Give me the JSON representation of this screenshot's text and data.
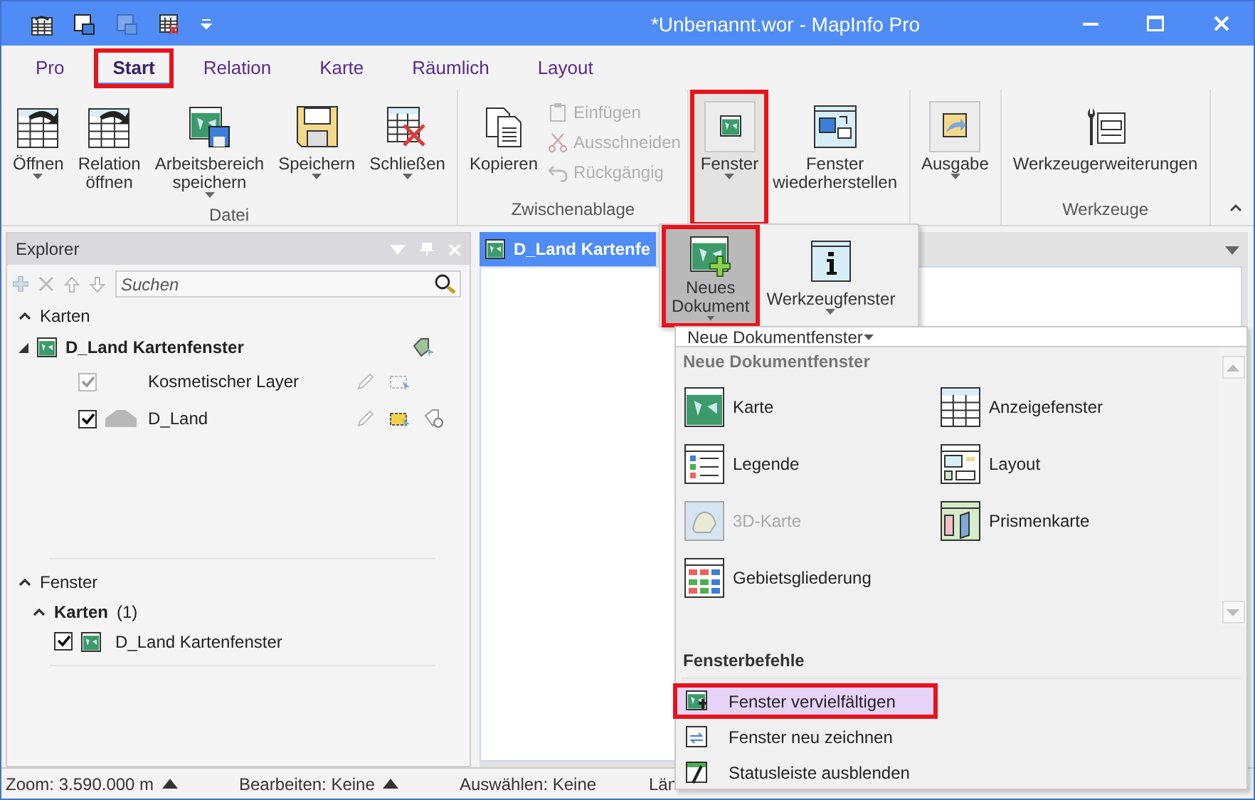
{
  "window": {
    "title": "*Unbenannt.wor - MapInfo Pro"
  },
  "tabs": [
    {
      "label": "Pro",
      "selected": false,
      "highlighted": false
    },
    {
      "label": "Start",
      "selected": true,
      "highlighted": true
    },
    {
      "label": "Relation",
      "selected": false,
      "highlighted": false
    },
    {
      "label": "Karte",
      "selected": false,
      "highlighted": false
    },
    {
      "label": "Räumlich",
      "selected": false,
      "highlighted": false
    },
    {
      "label": "Layout",
      "selected": false,
      "highlighted": false
    }
  ],
  "ribbon": {
    "groups": [
      {
        "label": "Datei",
        "buttons": [
          {
            "label": "Öffnen",
            "kind": "large",
            "dropdown": true,
            "pressed": false,
            "highlighted": false
          },
          {
            "label": "Relation\nöffnen",
            "kind": "large",
            "dropdown": false,
            "pressed": false,
            "highlighted": false
          },
          {
            "label": "Arbeitsbereich\nspeichern",
            "kind": "large",
            "dropdown": true,
            "pressed": false,
            "highlighted": false
          },
          {
            "label": "Speichern",
            "kind": "large",
            "dropdown": true,
            "pressed": false,
            "highlighted": false
          },
          {
            "label": "Schließen",
            "kind": "large",
            "dropdown": true,
            "pressed": false,
            "highlighted": false
          }
        ]
      },
      {
        "label": "Zwischenablage",
        "buttons": [
          {
            "label": "Kopieren",
            "kind": "large",
            "dropdown": false,
            "pressed": false,
            "highlighted": false
          },
          {
            "label": "Einfügen",
            "kind": "small",
            "disabled": true
          },
          {
            "label": "Ausschneiden",
            "kind": "small",
            "disabled": true
          },
          {
            "label": "Rückgängig",
            "kind": "small",
            "disabled": true
          }
        ]
      },
      {
        "buttons": [
          {
            "label": "Fenster",
            "kind": "large",
            "dropdown": true,
            "pressed": true,
            "highlighted": true
          },
          {
            "label": "Fenster\nwiederherstellen",
            "kind": "large",
            "dropdown": false,
            "pressed": false,
            "highlighted": false
          }
        ]
      },
      {
        "buttons": [
          {
            "label": "Ausgabe",
            "kind": "large",
            "dropdown": true,
            "pressed": false,
            "highlighted": false
          }
        ]
      },
      {
        "label": "Werkzeuge",
        "buttons": [
          {
            "label": "Werkzeugerweiterungen",
            "kind": "large",
            "dropdown": false,
            "pressed": false,
            "highlighted": false
          }
        ]
      }
    ]
  },
  "explorer": {
    "title": "Explorer",
    "search": {
      "placeholder": "Suchen"
    },
    "maps": {
      "label": "Karten",
      "expanded": true,
      "windows": [
        {
          "name": "D_Land Kartenfenster",
          "expanded": true,
          "layers": [
            {
              "name": "Kosmetischer Layer",
              "checked": true,
              "disabled": true
            },
            {
              "name": "D_Land",
              "checked": true,
              "disabled": false
            }
          ]
        }
      ]
    },
    "windows": {
      "label": "Fenster",
      "expanded": true,
      "groups": [
        {
          "label": "Karten",
          "count": "(1)",
          "expanded": true,
          "items": [
            {
              "name": "D_Land Kartenfenster",
              "checked": true
            }
          ]
        }
      ]
    }
  },
  "map_window": {
    "title": "D_Land Kartenfe"
  },
  "status_bar": [
    {
      "text": "Zoom: 3.590.000 m",
      "menu": true
    },
    {
      "text": "Bearbeiten: Keine",
      "menu": true
    },
    {
      "text": "Auswählen: Keine",
      "menu": false
    },
    {
      "text": "Län"
    }
  ],
  "window_popup": {
    "buttons": [
      {
        "label": "Neues\nDokument",
        "dropdown": true,
        "pressed": true,
        "highlighted": true
      },
      {
        "label": "Werkzeugfenster",
        "dropdown": true,
        "pressed": false,
        "highlighted": false
      }
    ]
  },
  "window_menu": {
    "filter": "Neue Dokumentfenster",
    "sections": [
      {
        "title": "Neue Dokumentfenster",
        "kind": "grid",
        "items": [
          {
            "label": "Karte",
            "disabled": false
          },
          {
            "label": "Anzeigefenster",
            "disabled": false
          },
          {
            "label": "Legende",
            "disabled": false
          },
          {
            "label": "Layout",
            "disabled": false
          },
          {
            "label": "3D-Karte",
            "disabled": true
          },
          {
            "label": "Prismenkarte",
            "disabled": false
          },
          {
            "label": "Gebietsgliederung",
            "disabled": false
          }
        ]
      },
      {
        "title": "Fensterbefehle",
        "kind": "list",
        "items": [
          {
            "label": "Fenster vervielfältigen",
            "selected": true,
            "highlighted": true
          },
          {
            "label": "Fenster neu zeichnen",
            "selected": false,
            "highlighted": false
          },
          {
            "label": "Statusleiste ausblenden",
            "selected": false,
            "highlighted": false
          }
        ]
      }
    ]
  }
}
